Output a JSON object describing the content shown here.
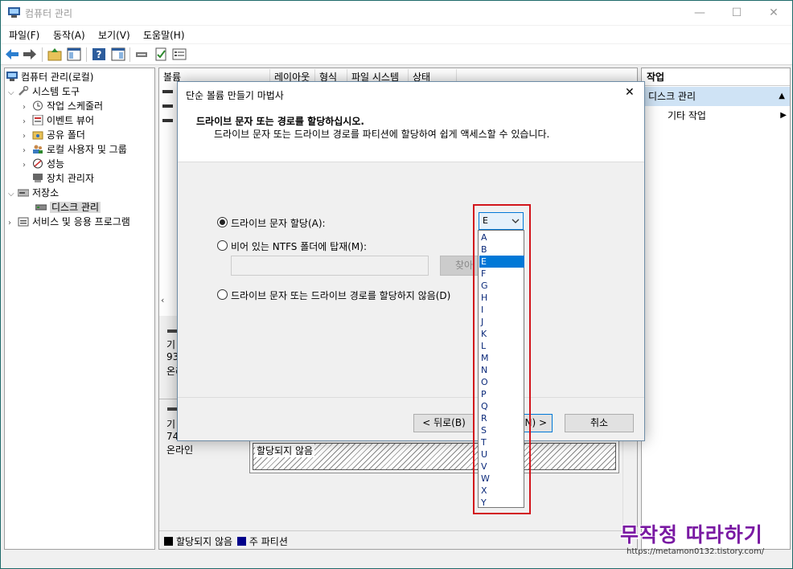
{
  "window": {
    "title": "컴퓨터 관리",
    "controls": {
      "minimize": "—",
      "maximize": "☐",
      "close": "✕"
    }
  },
  "menu": [
    "파일(F)",
    "동작(A)",
    "보기(V)",
    "도움말(H)"
  ],
  "tree": {
    "root": "컴퓨터 관리(로컬)",
    "system_tools": "시스템 도구",
    "task_scheduler": "작업 스케줄러",
    "event_viewer": "이벤트 뷰어",
    "shared_folders": "공유 폴더",
    "local_users": "로컬 사용자 및 그룹",
    "performance": "성능",
    "device_manager": "장치 관리자",
    "storage": "저장소",
    "disk_management": "디스크 관리",
    "services": "서비스 및 응용 프로그램"
  },
  "columns": [
    "볼륨",
    "레이아웃",
    "형식",
    "파일 시스템",
    "상태"
  ],
  "disk_panel": {
    "disk1_label_frag": "기",
    "disk1_size_frag": "93",
    "disk1_status_frag": "온리",
    "disk2_label_frag": "기",
    "disk2_size_frag": "74",
    "disk2_status": "온라인",
    "unallocated_text": "할당되지 않음"
  },
  "legend": {
    "unallocated": "할당되지 않음",
    "primary": "주 파티션"
  },
  "actions": {
    "header": "작업",
    "section": "디스크 관리",
    "more": "기타 작업"
  },
  "dialog": {
    "title": "단순 볼륨 만들기 마법사",
    "heading": "드라이브 문자 또는 경로를 할당하십시오.",
    "subheading": "드라이브 문자 또는 드라이브 경로를 파티션에 할당하여 쉽게 액세스할 수 있습니다.",
    "option_assign": "드라이브 문자 할당(A):",
    "option_mount": "비어 있는 NTFS 폴더에 탑재(M):",
    "browse": "찾아",
    "option_none": "드라이브 문자 또는 드라이브 경로를 할당하지 않음(D)",
    "back": "< 뒤로(B)",
    "next_frag": "N) >",
    "cancel": "취소"
  },
  "dropdown": {
    "selected": "E",
    "options": [
      "A",
      "B",
      "E",
      "F",
      "G",
      "H",
      "I",
      "J",
      "K",
      "L",
      "M",
      "N",
      "O",
      "P",
      "Q",
      "R",
      "S",
      "T",
      "U",
      "V",
      "W",
      "X",
      "Y"
    ],
    "highlighted_index": 2
  },
  "watermark": {
    "text": "무작정 따라하기",
    "url": "https://metamon0132.tistory.com/"
  },
  "colors": {
    "selection": "#0078d7",
    "highlight_box": "#d2151c",
    "legend_unallocated": "#000000",
    "legend_primary": "#00008b",
    "action_section_bg": "#cfe3f5",
    "watermark": "#7a1aa3"
  }
}
